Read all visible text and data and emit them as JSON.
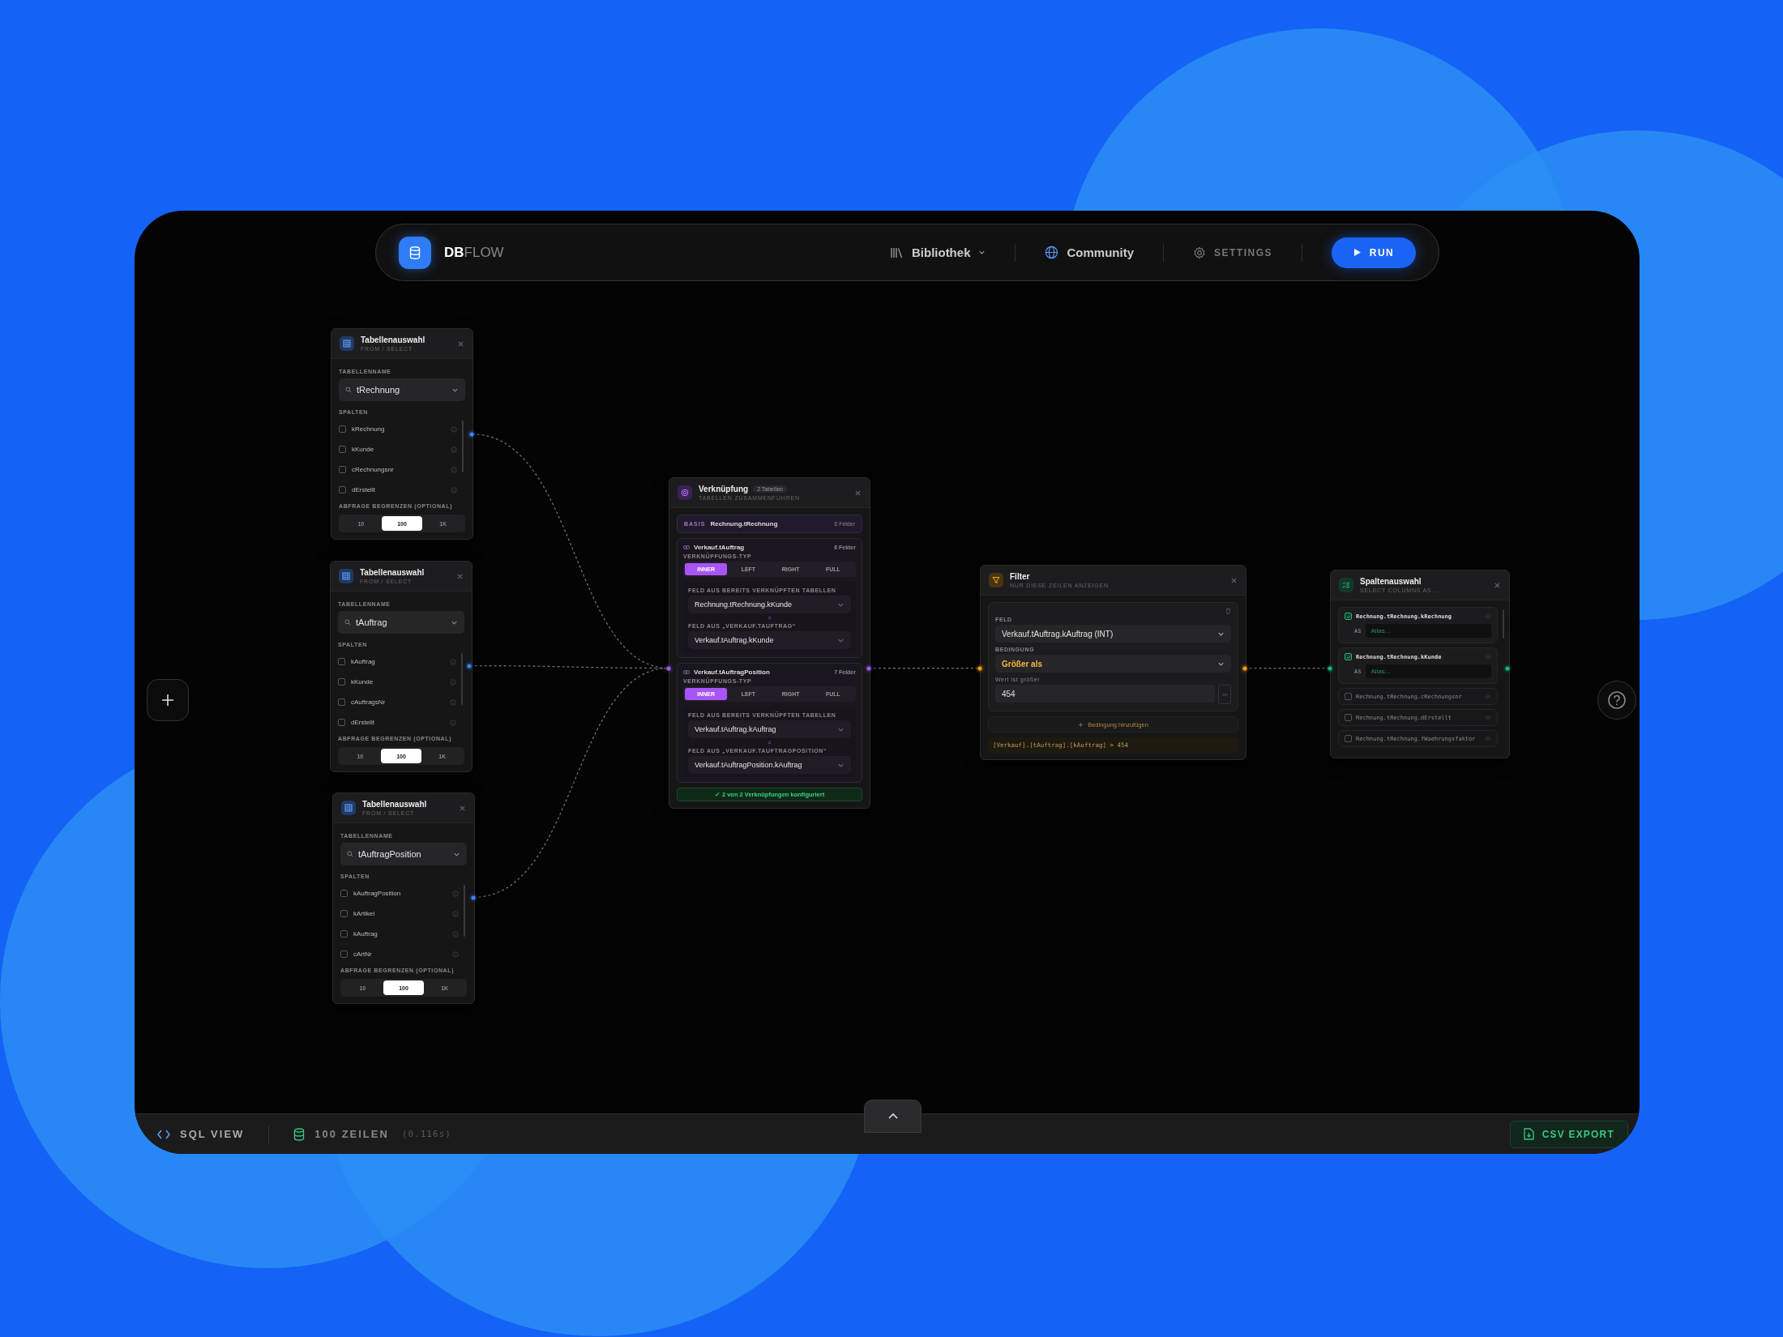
{
  "header": {
    "logo_bold": "DB",
    "logo_light": "FLOW",
    "nav": [
      {
        "label": "Bibliothek",
        "kind": "dropdown"
      },
      {
        "label": "Community",
        "kind": "link"
      },
      {
        "label": "SETTINGS",
        "kind": "settings"
      }
    ],
    "run_button": "RUN"
  },
  "table_nodes": [
    {
      "title": "Tabellenauswahl",
      "subtitle": "FROM / SELECT",
      "table_label": "TABELLENNAME",
      "table": "tRechnung",
      "columns_label": "SPALTEN",
      "columns": [
        {
          "name": "kRechnung",
          "checked": false
        },
        {
          "name": "kKunde",
          "checked": false
        },
        {
          "name": "cRechnungsnr",
          "checked": false
        },
        {
          "name": "dErstellt",
          "checked": false
        }
      ],
      "limit_label": "ABFRAGE BEGRENZEN (OPTIONAL)",
      "limits": [
        {
          "label": "10",
          "selected": false
        },
        {
          "label": "100",
          "selected": true
        },
        {
          "label": "1K",
          "selected": false
        }
      ]
    },
    {
      "title": "Tabellenauswahl",
      "subtitle": "FROM / SELECT",
      "table_label": "TABELLENNAME",
      "table": "tAuftrag",
      "columns_label": "SPALTEN",
      "columns": [
        {
          "name": "kAuftrag",
          "checked": false
        },
        {
          "name": "kKunde",
          "checked": false
        },
        {
          "name": "cAuftragsNr",
          "checked": false
        },
        {
          "name": "dErstellt",
          "checked": false
        }
      ],
      "limit_label": "ABFRAGE BEGRENZEN (OPTIONAL)",
      "limits": [
        {
          "label": "10",
          "selected": false
        },
        {
          "label": "100",
          "selected": true
        },
        {
          "label": "1K",
          "selected": false
        }
      ]
    },
    {
      "title": "Tabellenauswahl",
      "subtitle": "FROM / SELECT",
      "table_label": "TABELLENNAME",
      "table": "tAuftragPosition",
      "columns_label": "SPALTEN",
      "columns": [
        {
          "name": "kAuftragPosition",
          "checked": false
        },
        {
          "name": "kArtikel",
          "checked": false
        },
        {
          "name": "kAuftrag",
          "checked": false
        },
        {
          "name": "cArtNr",
          "checked": false
        }
      ],
      "limit_label": "ABFRAGE BEGRENZEN (OPTIONAL)",
      "limits": [
        {
          "label": "10",
          "selected": false
        },
        {
          "label": "100",
          "selected": true
        },
        {
          "label": "1K",
          "selected": false
        }
      ]
    }
  ],
  "join_node": {
    "title": "Verknüpfung",
    "badge": "2 Tabellen",
    "subtitle": "TABELLEN ZUSAMMENFÜHREN",
    "base": {
      "tag": "BASIS",
      "table": "Rechnung.tRechnung",
      "fields": "6 Felder"
    },
    "joins": [
      {
        "table": "Verkauf.tAuftrag",
        "fields": "6 Felder",
        "type_label": "VERKNÜPFUNGS-TYP",
        "types": [
          {
            "label": "INNER",
            "selected": true
          },
          {
            "label": "LEFT",
            "selected": false
          },
          {
            "label": "RIGHT",
            "selected": false
          },
          {
            "label": "FULL",
            "selected": false
          }
        ],
        "left_label": "FELD AUS BEREITS VERKNÜPFTEN TABELLEN",
        "left_value": "Rechnung.tRechnung.kKunde",
        "equals": "=",
        "right_label": "FELD AUS „VERKAUF.TAUFTRAG“",
        "right_value": "Verkauf.tAuftrag.kKunde"
      },
      {
        "table": "Verkauf.tAuftragPosition",
        "fields": "7 Felder",
        "type_label": "VERKNÜPFUNGS-TYP",
        "types": [
          {
            "label": "INNER",
            "selected": true
          },
          {
            "label": "LEFT",
            "selected": false
          },
          {
            "label": "RIGHT",
            "selected": false
          },
          {
            "label": "FULL",
            "selected": false
          }
        ],
        "left_label": "FELD AUS BEREITS VERKNÜPFTEN TABELLEN",
        "left_value": "Verkauf.tAuftrag.kAuftrag",
        "equals": "=",
        "right_label": "FELD AUS „VERKAUF.TAUFTRAGPOSITION“",
        "right_value": "Verkauf.tAuftragPosition.kAuftrag"
      }
    ],
    "status": "✓ 2 von 2 Verknüpfungen konfiguriert"
  },
  "filter_node": {
    "title": "Filter",
    "subtitle": "NUR DIESE ZEILEN ANZEIGEN",
    "field_label": "FELD",
    "field": "Verkauf.tAuftrag.kAuftrag (INT)",
    "condition_label": "BEDINGUNG",
    "condition": "Größer als",
    "value_label": "Wert ist größer",
    "value": "454",
    "add_condition": "Bedingung hinzufügen",
    "sql": "[Verkauf].[tAuftrag].[kAuftrag] > 454"
  },
  "columns_node": {
    "title": "Spaltenauswahl",
    "subtitle": "SELECT COLUMNS AS ...",
    "columns": [
      {
        "name": "Rechnung.tRechnung.kRechnung",
        "checked": true,
        "alias_prefix": "AS",
        "alias_placeholder": "Alias..."
      },
      {
        "name": "Rechnung.tRechnung.kKunde",
        "checked": true,
        "alias_prefix": "AS",
        "alias_placeholder": "Alias..."
      },
      {
        "name": "Rechnung.tRechnung.cRechnungsnr",
        "checked": false
      },
      {
        "name": "Rechnung.tRechnung.dErstellt",
        "checked": false
      },
      {
        "name": "Rechnung.tRechnung.fWaehrungsfaktor",
        "checked": false
      }
    ]
  },
  "bottom_bar": {
    "sql_view": "SQL VIEW",
    "rows": "100 ZEILEN",
    "time": "(0.116s)",
    "export": "CSV EXPORT"
  }
}
